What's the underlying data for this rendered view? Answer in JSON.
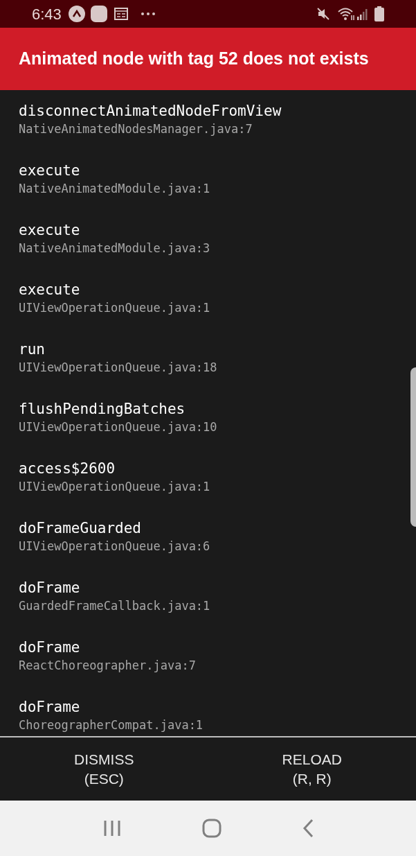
{
  "status_bar": {
    "time": "6:43"
  },
  "header": {
    "title": "Animated node with tag 52 does not exists"
  },
  "frames": [
    {
      "method": "disconnectAnimatedNodeFromView",
      "location": "NativeAnimatedNodesManager.java:7"
    },
    {
      "method": "execute",
      "location": "NativeAnimatedModule.java:1"
    },
    {
      "method": "execute",
      "location": "NativeAnimatedModule.java:3"
    },
    {
      "method": "execute",
      "location": "UIViewOperationQueue.java:1"
    },
    {
      "method": "run",
      "location": "UIViewOperationQueue.java:18"
    },
    {
      "method": "flushPendingBatches",
      "location": "UIViewOperationQueue.java:10"
    },
    {
      "method": "access$2600",
      "location": "UIViewOperationQueue.java:1"
    },
    {
      "method": "doFrameGuarded",
      "location": "UIViewOperationQueue.java:6"
    },
    {
      "method": "doFrame",
      "location": "GuardedFrameCallback.java:1"
    },
    {
      "method": "doFrame",
      "location": "ReactChoreographer.java:7"
    },
    {
      "method": "doFrame",
      "location": "ChoreographerCompat.java:1"
    }
  ],
  "buttons": [
    {
      "label": "DISMISS",
      "shortcut": "(ESC)"
    },
    {
      "label": "RELOAD",
      "shortcut": "(R, R)"
    }
  ]
}
